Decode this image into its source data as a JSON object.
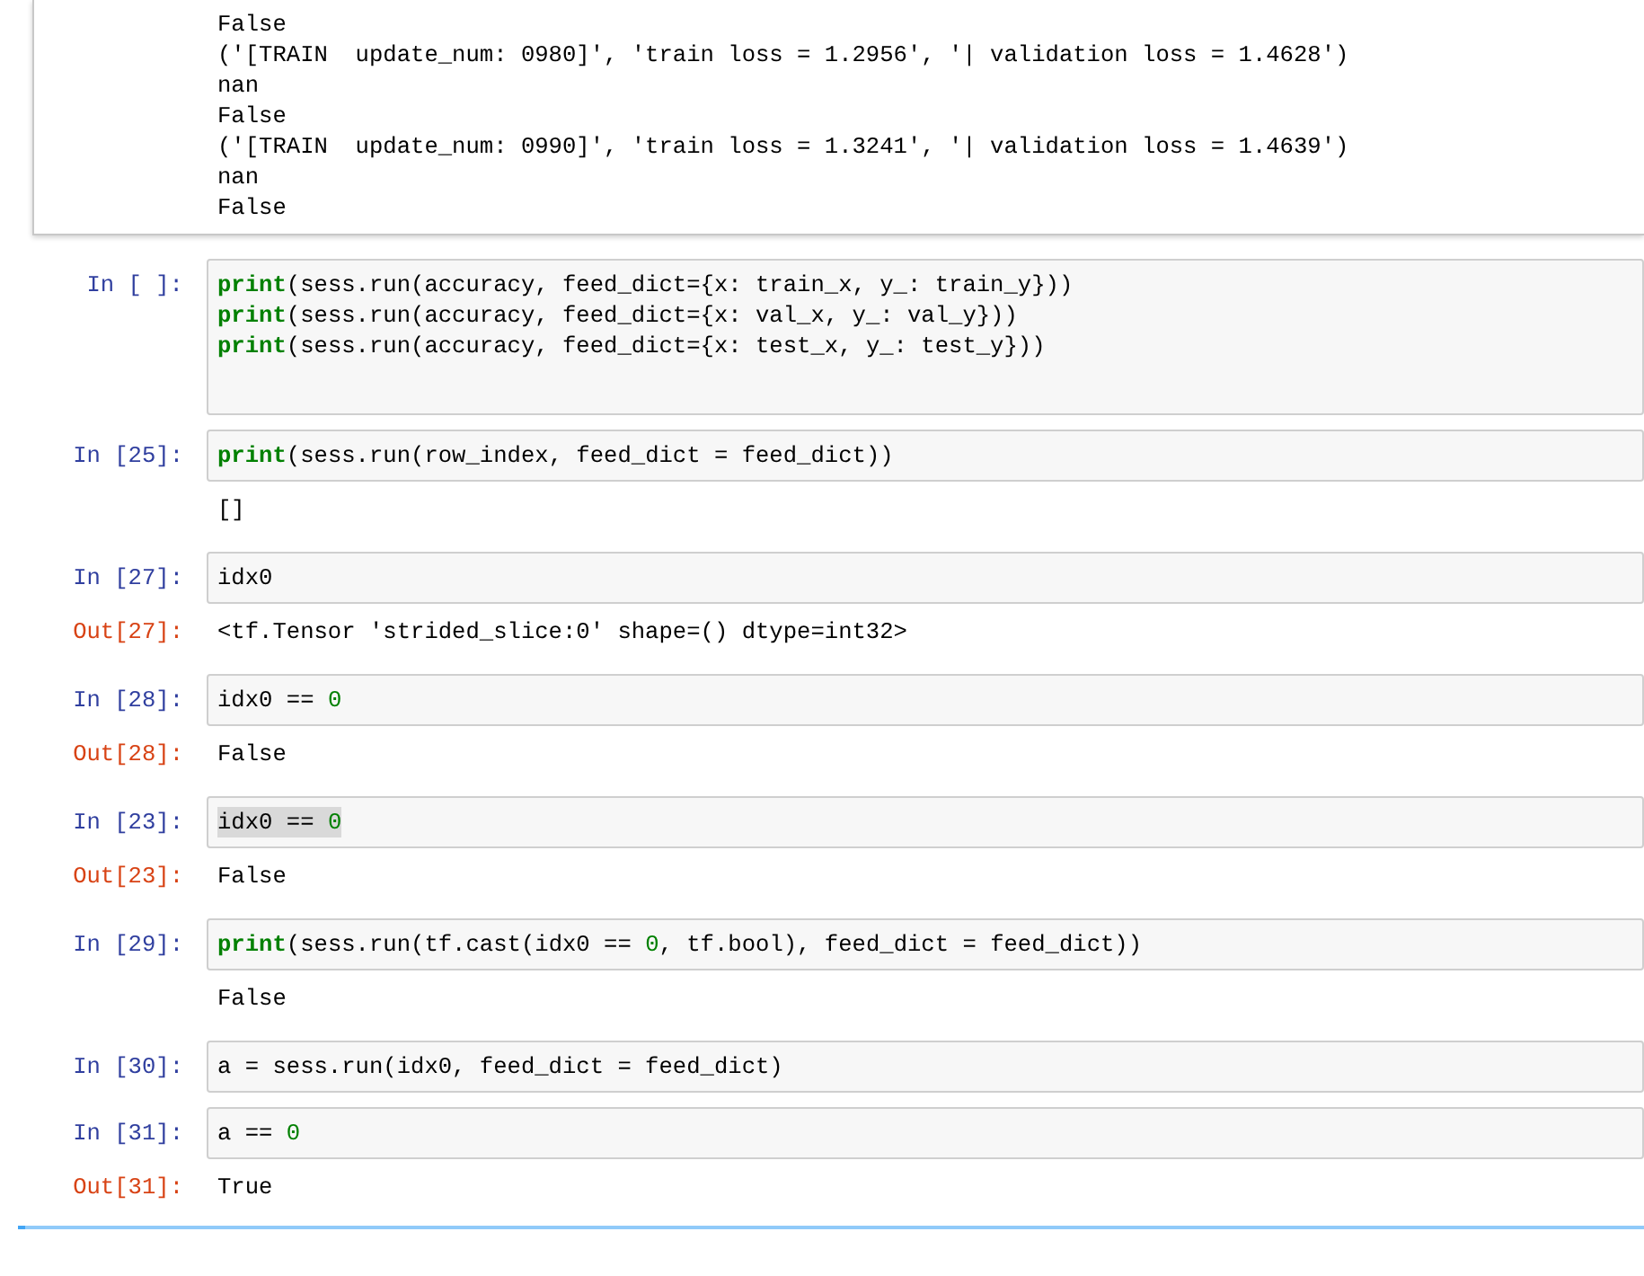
{
  "scrolled_output": {
    "lines": [
      "False",
      "('[TRAIN  update_num: 0980]', 'train loss = 1.2956', '| validation loss = 1.4628')",
      "nan",
      "False",
      "('[TRAIN  update_num: 0990]', 'train loss = 1.3241', '| validation loss = 1.4639')",
      "nan",
      "False"
    ]
  },
  "cells": [
    {
      "prompt": "In [ ]:",
      "code": [
        {
          "selected": false,
          "tokens": [
            {
              "kind": "builtin",
              "text": "print"
            },
            {
              "kind": "plain",
              "text": "(sess.run(accuracy, feed_dict={x: train_x, y_: train_y}))"
            }
          ]
        },
        {
          "selected": false,
          "tokens": [
            {
              "kind": "builtin",
              "text": "print"
            },
            {
              "kind": "plain",
              "text": "(sess.run(accuracy, feed_dict={x: val_x, y_: val_y}))"
            }
          ]
        },
        {
          "selected": false,
          "tokens": [
            {
              "kind": "builtin",
              "text": "print"
            },
            {
              "kind": "plain",
              "text": "(sess.run(accuracy, feed_dict={x: test_x, y_: test_y}))"
            }
          ]
        }
      ]
    },
    {
      "prompt": "In [25]:",
      "code": [
        {
          "selected": false,
          "tokens": [
            {
              "kind": "builtin",
              "text": "print"
            },
            {
              "kind": "plain",
              "text": "(sess.run(row_index, feed_dict = feed_dict))"
            }
          ]
        }
      ],
      "output": {
        "text": "[]"
      }
    },
    {
      "prompt": "In [27]:",
      "code": [
        {
          "selected": false,
          "tokens": [
            {
              "kind": "plain",
              "text": "idx0"
            }
          ]
        }
      ],
      "output": {
        "prompt": "Out[27]:",
        "text": "<tf.Tensor 'strided_slice:0' shape=() dtype=int32>"
      }
    },
    {
      "prompt": "In [28]:",
      "code": [
        {
          "selected": false,
          "tokens": [
            {
              "kind": "plain",
              "text": "idx0 == "
            },
            {
              "kind": "number",
              "text": "0"
            }
          ]
        }
      ],
      "output": {
        "prompt": "Out[28]:",
        "text": "False"
      }
    },
    {
      "prompt": "In [23]:",
      "code": [
        {
          "selected": true,
          "tokens": [
            {
              "kind": "plain",
              "text": "idx0 == "
            },
            {
              "kind": "number",
              "text": "0"
            }
          ]
        }
      ],
      "output": {
        "prompt": "Out[23]:",
        "text": "False"
      }
    },
    {
      "prompt": "In [29]:",
      "code": [
        {
          "selected": false,
          "tokens": [
            {
              "kind": "builtin",
              "text": "print"
            },
            {
              "kind": "plain",
              "text": "(sess.run(tf.cast(idx0 == "
            },
            {
              "kind": "number",
              "text": "0"
            },
            {
              "kind": "plain",
              "text": ", tf.bool), feed_dict = feed_dict))"
            }
          ]
        }
      ],
      "output": {
        "text": "False"
      }
    },
    {
      "prompt": "In [30]:",
      "code": [
        {
          "selected": false,
          "tokens": [
            {
              "kind": "plain",
              "text": "a = sess.run(idx0, feed_dict = feed_dict)"
            }
          ]
        }
      ]
    },
    {
      "prompt": "In [31]:",
      "code": [
        {
          "selected": false,
          "tokens": [
            {
              "kind": "plain",
              "text": "a == "
            },
            {
              "kind": "number",
              "text": "0"
            }
          ]
        }
      ],
      "output": {
        "prompt": "Out[31]:",
        "text": "True"
      }
    }
  ]
}
